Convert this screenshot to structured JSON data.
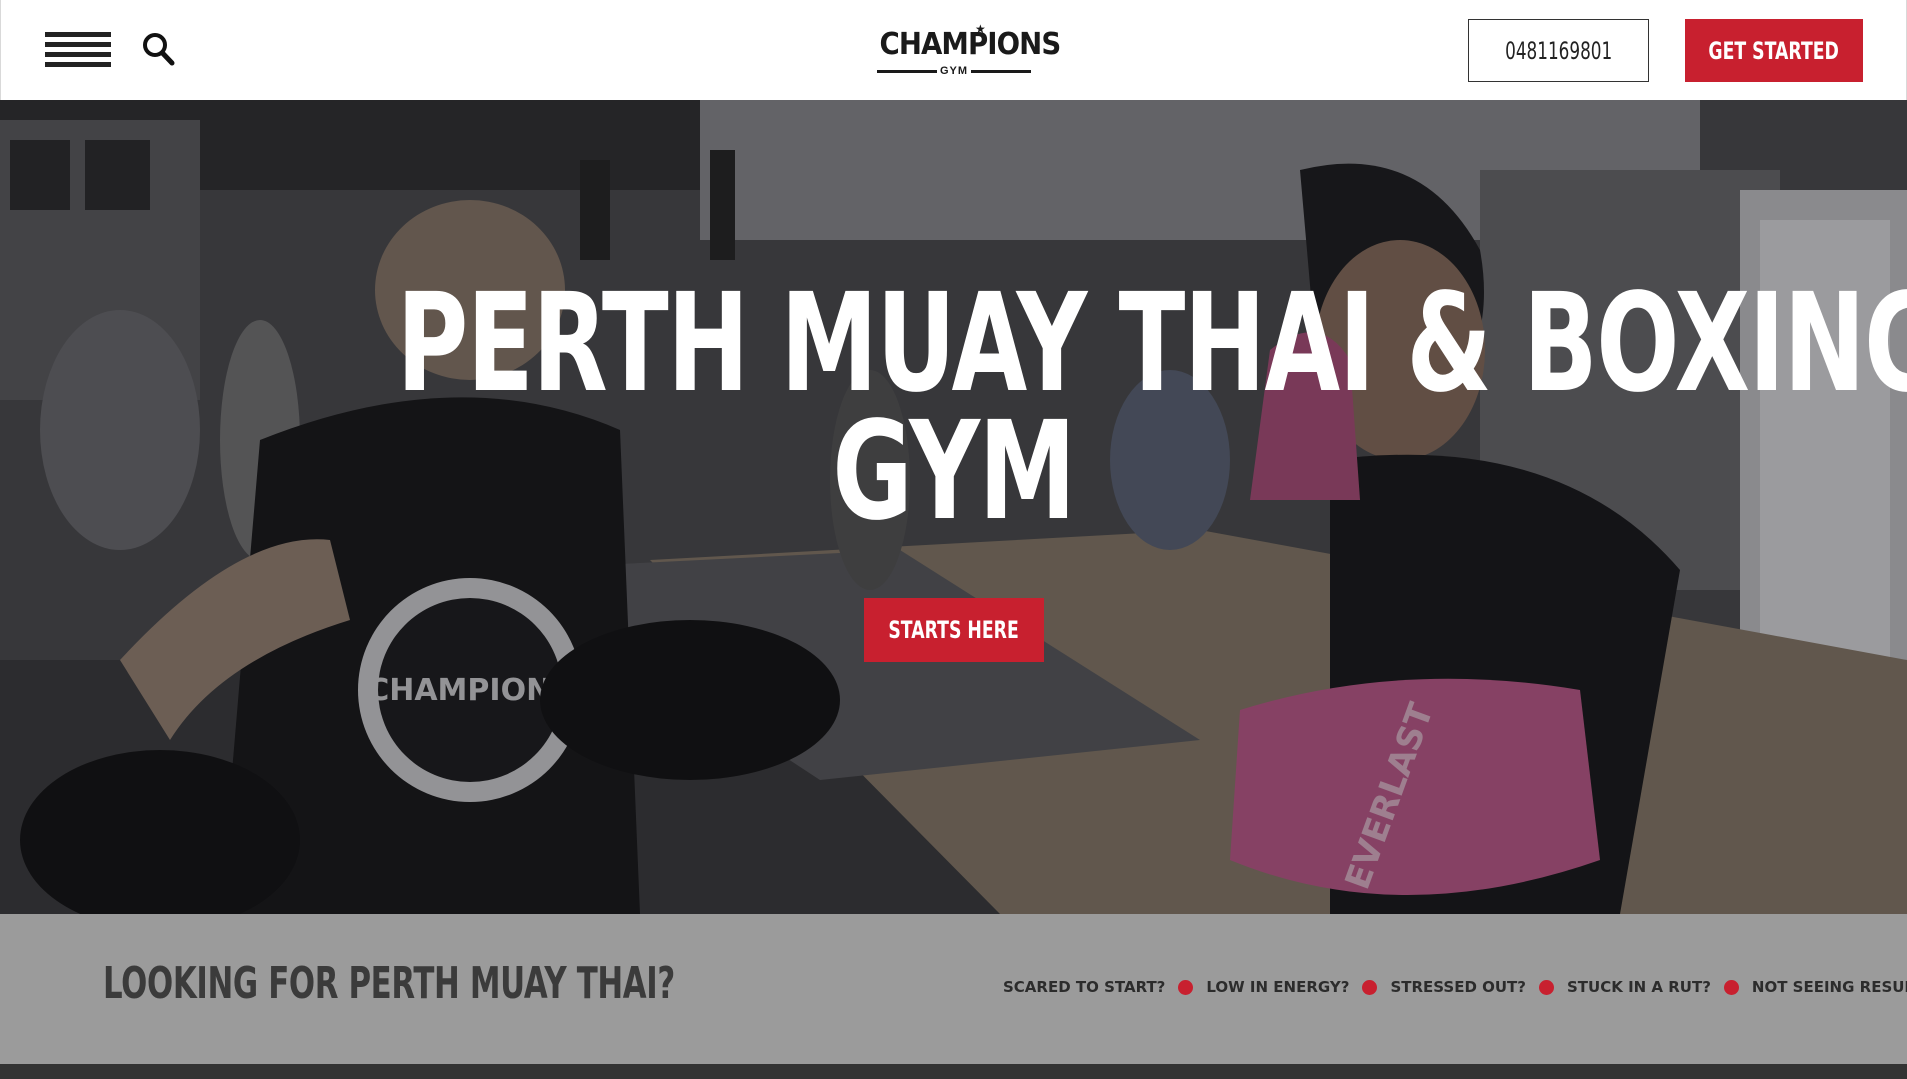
{
  "header": {
    "logo_text": "CHAMPIONS",
    "logo_sub": "GYM",
    "phone": "0481169801",
    "cta_label": "GET STARTED"
  },
  "hero": {
    "title_line1": "PERTH MUAY THAI & BOXING",
    "title_line2": "GYM",
    "cta_label": "STARTS HERE",
    "shirt_logo_text": "CHAMPIONS",
    "glove_brand": "EVERLAST"
  },
  "band": {
    "title": "LOOKING FOR PERTH MUAY THAI?",
    "items": [
      "SCARED TO START?",
      "LOW IN ENERGY?",
      "STRESSED OUT?",
      "STUCK IN A RUT?",
      "NOT SEEING RESULTS?"
    ]
  },
  "colors": {
    "accent": "#c8202f",
    "band_bg": "#9b9b9b",
    "dark": "#222222"
  },
  "icons": {
    "menu": "hamburger-menu-icon",
    "search": "search-icon"
  }
}
